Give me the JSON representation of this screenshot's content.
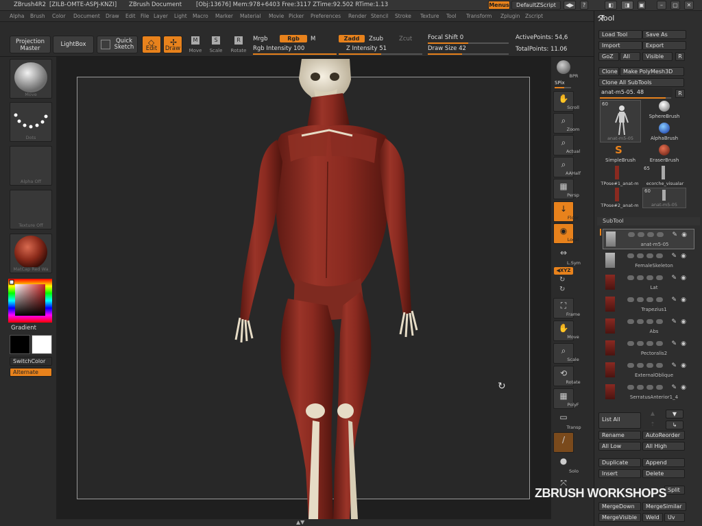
{
  "titlebar": {
    "app": "ZBrush4R2",
    "serial": "[ZILB-OMTE-ASPJ-KNZI]",
    "doc": "ZBrush Document",
    "stats": "[Obj:13676] Mem:978+6403 Free:3117 ZTime:92.502 RTime:1.13",
    "menus_label": "Menus",
    "zscript_label": "DefaultZScript"
  },
  "menubar": [
    "Alpha",
    "Brush",
    "Color",
    "Document",
    "Draw",
    "Edit",
    "File",
    "Layer",
    "Light",
    "Macro",
    "Marker",
    "Material",
    "Movie",
    "Picker",
    "Preferences",
    "Render",
    "Stencil",
    "Stroke",
    "Texture",
    "Tool",
    "Transform",
    "Zplugin",
    "Zscript"
  ],
  "toolbar": {
    "projection_master": "Projection Master",
    "lightbox": "LightBox",
    "quick_sketch": "Quick Sketch",
    "edit": "Edit",
    "draw": "Draw",
    "move": "Move",
    "scale": "Scale",
    "rotate": "Rotate",
    "move_icon_letter": "M",
    "scale_icon_letter": "S",
    "rotate_icon_letter": "R",
    "mrgb": "Mrgb",
    "rgb": "Rgb",
    "m": "M",
    "zadd": "Zadd",
    "zsub": "Zsub",
    "zcut": "Zcut",
    "rgb_intensity_label": "Rgb Intensity",
    "rgb_intensity": "100",
    "rgb_intensity_value": 1.0,
    "z_intensity_label": "Z Intensity",
    "z_intensity": "51",
    "z_intensity_value": 0.51,
    "focal_shift_label": "Focal Shift",
    "focal_shift": "0",
    "draw_size_label": "Draw Size",
    "draw_size": "42",
    "active_points": "ActivePoints: 54,6",
    "total_points": "TotalPoints: 11.06"
  },
  "leftshelf": {
    "move": "Move",
    "dots": "Dots",
    "alpha_off": "Alpha Off",
    "texture_off": "Texture Off",
    "matcap": "MatCap Red Wa",
    "gradient": "Gradient",
    "switch_color": "SwitchColor",
    "alternate": "Alternate"
  },
  "rightshelf": {
    "brill": "BPR",
    "spix_label": "SPix",
    "scroll": "Scroll",
    "zoom": "Zoom",
    "actual": "Actual",
    "aahalf": "AAHalf",
    "persp": "Persp",
    "floor": "Floor",
    "local": "Local",
    "lsym": "L.Sym",
    "xyz": "◀XYZ",
    "frame": "Frame",
    "move": "Move",
    "scale": "Scale",
    "rotate": "Rotate",
    "polyf": "PolyF",
    "transp": "Transp",
    "ghost": "Ghost",
    "solo": "Solo",
    "xpose": "Xpose"
  },
  "tool_panel": {
    "title": "Tool",
    "load_tool": "Load Tool",
    "save_as": "Save As",
    "import": "Import",
    "export": "Export",
    "goz": "GoZ",
    "all": "All",
    "visible": "Visible",
    "r": "R",
    "clone": "Clone",
    "make_polymesh": "Make PolyMesh3D",
    "clone_all": "Clone All SubTools",
    "current_tool": "anat-m5-05. 48",
    "tools": [
      {
        "name": "anat-m5-05",
        "count": "60"
      },
      {
        "name": "SphereBrush"
      },
      {
        "name": "AlphaBrush"
      },
      {
        "name": "SimpleBrush"
      },
      {
        "name": "EraserBrush"
      },
      {
        "name": "TPose#1_anat-m",
        "count": "65"
      },
      {
        "name": "ecorche_visualar"
      },
      {
        "name": "TPose#2_anat-m"
      },
      {
        "name": "anat-m5-05",
        "count": "60"
      }
    ],
    "subtool_header": "SubTool",
    "subtools": [
      "anat-m5-05",
      "FemaleSkeleton",
      "Lat",
      "Trapezius1",
      "Abs",
      "Pectoralis2",
      "ExternalOblique",
      "SerratusAnterior1_4"
    ],
    "list_all": "List All",
    "rename": "Rename",
    "auto_reorder": "AutoReorder",
    "all_low": "All Low",
    "all_high": "All High",
    "duplicate": "Duplicate",
    "append": "Append",
    "insert": "Insert",
    "delete": "Delete",
    "split": "Split",
    "merge_down": "MergeDown",
    "merge_similar": "MergeSimilar",
    "merge_visible": "MergeVisible",
    "weld": "Weld",
    "uv": "Uv"
  },
  "watermark": "ZBRUSH WORKSHOPS",
  "colors": {
    "accent": "#e8821c",
    "muscle": "#8a2a22",
    "bone": "#e6dcc6"
  }
}
